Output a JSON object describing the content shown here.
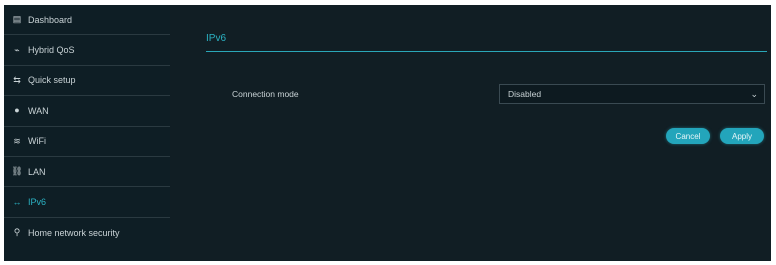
{
  "sidebar": {
    "items": [
      {
        "label": "Dashboard",
        "icon": "dashboard-icon",
        "glyph": "▤"
      },
      {
        "label": "Hybrid QoS",
        "icon": "qos-icon",
        "glyph": "⌁"
      },
      {
        "label": "Quick setup",
        "icon": "quick-setup-icon",
        "glyph": "⇆"
      },
      {
        "label": "WAN",
        "icon": "globe-icon",
        "glyph": "●"
      },
      {
        "label": "WiFi",
        "icon": "wifi-icon",
        "glyph": "≋"
      },
      {
        "label": "LAN",
        "icon": "lan-icon",
        "glyph": "⛓"
      },
      {
        "label": "IPv6",
        "icon": "ipv6-icon",
        "glyph": "↔"
      },
      {
        "label": "Home network security",
        "icon": "security-icon",
        "glyph": "⚲"
      }
    ],
    "active_index": 6
  },
  "main": {
    "title": "IPv6",
    "connection_mode_label": "Connection mode",
    "connection_mode_value": "Disabled",
    "cancel_label": "Cancel",
    "apply_label": "Apply"
  },
  "colors": {
    "accent": "#2bb3c4",
    "background": "#111e24",
    "sidebar": "#0e1e25"
  }
}
